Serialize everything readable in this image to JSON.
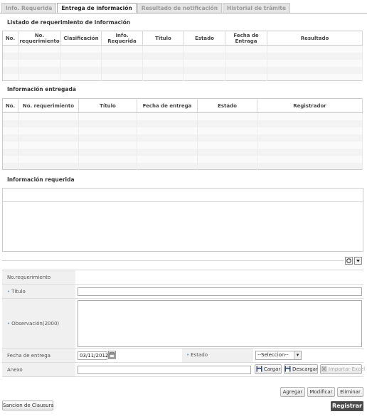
{
  "tabs": [
    {
      "label": "Info. Requerida",
      "active": false
    },
    {
      "label": "Entrega de información",
      "active": true
    },
    {
      "label": "Resultado de notificación",
      "active": false
    },
    {
      "label": "Historial de trámite",
      "active": false
    }
  ],
  "section1": {
    "title": "Listado de requerimiento de información",
    "columns": [
      "No.",
      "No. requerimiento",
      "Clasificación",
      "Info. Requerida",
      "Título",
      "Estado",
      "Fecha de Entraga",
      "Resultado"
    ]
  },
  "section2": {
    "title": "Información entregada",
    "columns": [
      "No.",
      "No. requerimiento",
      "Título",
      "Fecha de entrega",
      "Estado",
      "Registrador"
    ]
  },
  "section3": {
    "title": "Información requerida"
  },
  "toolbar_icons": [
    "refresh-icon",
    "chevron-down-icon"
  ],
  "form": {
    "no_requerimiento_label": "No.requerimiento",
    "titulo_label": "Título",
    "observacion_label": "Observación(2000)",
    "fecha_label": "Fecha de entrega",
    "fecha_value": "03/11/2012",
    "estado_label": "Estado",
    "estado_value": "--Seleccion--",
    "anexo_label": "Anexo",
    "cargar": "Cargar",
    "descargar": "Descargar",
    "importar": "Importar Excel"
  },
  "actions": {
    "agregar": "Agregar",
    "modificar": "Modificar",
    "eliminar": "Eliminar",
    "sancion": "Sancion de Clausura",
    "registrar": "Registrar"
  }
}
